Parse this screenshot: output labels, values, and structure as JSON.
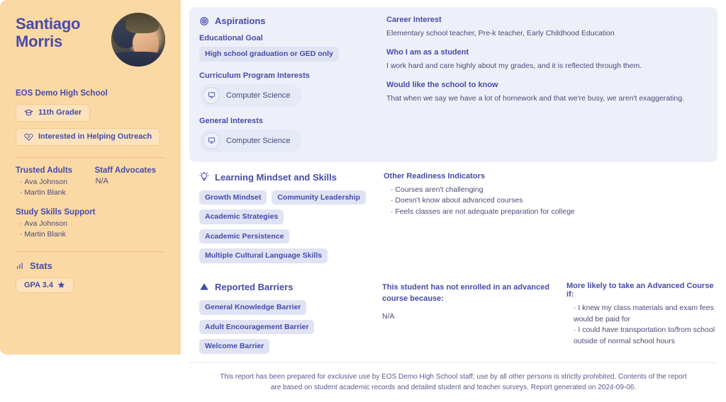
{
  "student": {
    "name": "Santiago Morris",
    "school": "EOS Demo High School",
    "grade_badge": "11th Grader",
    "outreach_badge": "Interested in Helping Outreach",
    "trusted_adults_label": "Trusted Adults",
    "trusted_adults": [
      "Ava Johnson",
      "Martin Blank"
    ],
    "staff_advocates_label": "Staff Advocates",
    "staff_advocates_value": "N/A",
    "study_skills_label": "Study Skills Support",
    "study_skills": [
      "Ava Johnson",
      "Martin Blank"
    ],
    "stats_label": "Stats",
    "gpa_label": "GPA 3.4"
  },
  "aspirations": {
    "title": "Aspirations",
    "educational_goal_label": "Educational Goal",
    "educational_goal_value": "High school graduation or GED only",
    "curriculum_label": "Curriculum Program Interests",
    "curriculum_items": [
      "Computer Science"
    ],
    "general_label": "General Interests",
    "general_items": [
      "Computer Science"
    ],
    "career_interest_label": "Career Interest",
    "career_interest_value": "Elementary school teacher, Pre-k teacher, Early Childhood Education",
    "who_i_am_label": "Who I am as a student",
    "who_i_am_value": "I work hard and care highly about my grades, and it is reflected through them.",
    "school_to_know_label": "Would like the school to know",
    "school_to_know_value": "That when we say we have a lot of homework and that we're busy, we aren't exaggerating."
  },
  "mindset": {
    "title": "Learning Mindset and Skills",
    "tag_rows": [
      [
        "Growth Mindset",
        "Community Leadership"
      ],
      [
        "Academic Strategies",
        "Academic Persistence"
      ],
      [
        "Multiple Cultural Language Skills"
      ]
    ],
    "readiness_label": "Other Readiness Indicators",
    "readiness_items": [
      "Courses aren't challenging",
      "Doesn't know about advanced courses",
      "Feels classes are not adequate preparation for college"
    ]
  },
  "barriers": {
    "title": "Reported Barriers",
    "tag_rows": [
      [
        "General Knowledge Barrier"
      ],
      [
        "Adult Encouragement Barrier",
        "Welcome Barrier"
      ]
    ],
    "not_enrolled_label": "This student has not enrolled in an advanced course because:",
    "not_enrolled_value": "N/A",
    "more_likely_label": "More likely to take an Advanced Course if:",
    "more_likely_items": [
      "I knew my class materials and exam fees would be paid for",
      "I could have transportation to/from school outside of normal school hours"
    ]
  },
  "footer": {
    "text": "This report has been prepared for exclusive use by EOS Demo High School staff; use by all other persons is strictly prohibited. Contents of the report are based on student academic records and detailed student and teacher surveys. Report generated on 2024-09-06."
  },
  "icons": {
    "aspirations": "target-icon",
    "mindset": "lightbulb-icon",
    "barriers": "warning-triangle-icon",
    "stats": "bar-chart-icon",
    "grade": "graduation-cap-icon",
    "outreach": "helping-hand-icon",
    "gpa": "star-icon",
    "interest": "monitor-icon"
  },
  "colors": {
    "sidebar_bg": "#fbd9a5",
    "accent": "#474ba8",
    "panel_bg": "#eef0f9",
    "tag_bg": "#dfe3f4"
  }
}
